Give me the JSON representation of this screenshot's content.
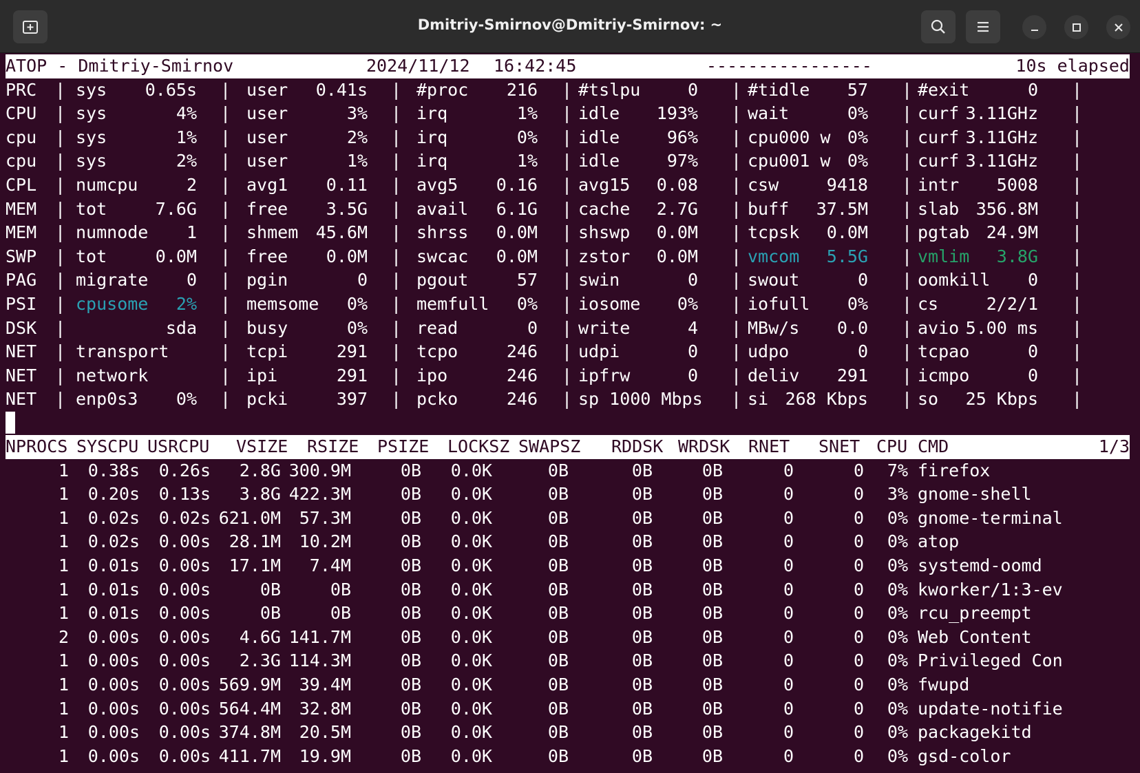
{
  "window": {
    "title": "Dmitriy-Smirnov@Dmitriy-Smirnov: ~"
  },
  "header": {
    "app": "ATOP - Dmitriy-Smirnov",
    "date": "2024/11/12",
    "time": "16:42:45",
    "dashes": "----------------",
    "elapsed": "10s elapsed"
  },
  "sys_rows": [
    {
      "label": "PRC",
      "cells": [
        {
          "k": "sys",
          "v": "0.65s"
        },
        {
          "k": "user",
          "v": "0.41s"
        },
        {
          "k": "#proc",
          "v": "216"
        },
        {
          "k": "#tslpu",
          "v": "0"
        },
        {
          "k": "#tidle",
          "v": "57"
        },
        {
          "k": "#exit",
          "v": "0"
        }
      ]
    },
    {
      "label": "CPU",
      "cells": [
        {
          "k": "sys",
          "v": "4%"
        },
        {
          "k": "user",
          "v": "3%"
        },
        {
          "k": "irq",
          "v": "1%"
        },
        {
          "k": "idle",
          "v": "193%"
        },
        {
          "k": "wait",
          "v": "0%"
        },
        {
          "k": "curf",
          "v": "3.11GHz"
        }
      ]
    },
    {
      "label": "cpu",
      "cells": [
        {
          "k": "sys",
          "v": "1%"
        },
        {
          "k": "user",
          "v": "2%"
        },
        {
          "k": "irq",
          "v": "0%"
        },
        {
          "k": "idle",
          "v": "96%"
        },
        {
          "k": "cpu000 w",
          "v": "0%"
        },
        {
          "k": "curf",
          "v": "3.11GHz"
        }
      ]
    },
    {
      "label": "cpu",
      "cells": [
        {
          "k": "sys",
          "v": "2%"
        },
        {
          "k": "user",
          "v": "1%"
        },
        {
          "k": "irq",
          "v": "1%"
        },
        {
          "k": "idle",
          "v": "97%"
        },
        {
          "k": "cpu001 w",
          "v": "0%"
        },
        {
          "k": "curf",
          "v": "3.11GHz"
        }
      ]
    },
    {
      "label": "CPL",
      "cells": [
        {
          "k": "numcpu",
          "v": "2"
        },
        {
          "k": "avg1",
          "v": "0.11"
        },
        {
          "k": "avg5",
          "v": "0.16"
        },
        {
          "k": "avg15",
          "v": "0.08"
        },
        {
          "k": "csw",
          "v": "9418"
        },
        {
          "k": "intr",
          "v": "5008"
        }
      ]
    },
    {
      "label": "MEM",
      "cells": [
        {
          "k": "tot",
          "v": "7.6G"
        },
        {
          "k": "free",
          "v": "3.5G"
        },
        {
          "k": "avail",
          "v": "6.1G"
        },
        {
          "k": "cache",
          "v": "2.7G"
        },
        {
          "k": "buff",
          "v": "37.5M"
        },
        {
          "k": "slab",
          "v": "356.8M"
        }
      ]
    },
    {
      "label": "MEM",
      "cells": [
        {
          "k": "numnode",
          "v": "1"
        },
        {
          "k": "shmem",
          "v": "45.6M"
        },
        {
          "k": "shrss",
          "v": "0.0M"
        },
        {
          "k": "shswp",
          "v": "0.0M"
        },
        {
          "k": "tcpsk",
          "v": "0.0M"
        },
        {
          "k": "pgtab",
          "v": "24.9M"
        }
      ]
    },
    {
      "label": "SWP",
      "cells": [
        {
          "k": "tot",
          "v": "0.0M"
        },
        {
          "k": "free",
          "v": "0.0M"
        },
        {
          "k": "swcac",
          "v": "0.0M"
        },
        {
          "k": "zstor",
          "v": "0.0M"
        },
        {
          "k": "vmcom",
          "v": "5.5G",
          "color": "cyan"
        },
        {
          "k": "vmlim",
          "v": "3.8G",
          "color": "green"
        }
      ]
    },
    {
      "label": "PAG",
      "cells": [
        {
          "k": "migrate",
          "v": "0"
        },
        {
          "k": "pgin",
          "v": "0"
        },
        {
          "k": "pgout",
          "v": "57"
        },
        {
          "k": "swin",
          "v": "0"
        },
        {
          "k": "swout",
          "v": "0"
        },
        {
          "k": "oomkill",
          "v": "0"
        }
      ]
    },
    {
      "label": "PSI",
      "cells": [
        {
          "k": "cpusome",
          "v": "2%",
          "color": "cyan"
        },
        {
          "k": "memsome",
          "v": "0%"
        },
        {
          "k": "memfull",
          "v": "0%"
        },
        {
          "k": "iosome",
          "v": "0%"
        },
        {
          "k": "iofull",
          "v": "0%"
        },
        {
          "k": "cs",
          "v": "2/2/1"
        }
      ]
    },
    {
      "label": "DSK",
      "cells": [
        {
          "k": "",
          "v": "sda"
        },
        {
          "k": "busy",
          "v": "0%"
        },
        {
          "k": "read",
          "v": "0"
        },
        {
          "k": "write",
          "v": "4"
        },
        {
          "k": "MBw/s",
          "v": "0.0"
        },
        {
          "k": "avio",
          "v": "5.00 ms"
        }
      ]
    },
    {
      "label": "NET",
      "cells": [
        {
          "k": "transport",
          "v": ""
        },
        {
          "k": "tcpi",
          "v": "291"
        },
        {
          "k": "tcpo",
          "v": "246"
        },
        {
          "k": "udpi",
          "v": "0"
        },
        {
          "k": "udpo",
          "v": "0"
        },
        {
          "k": "tcpao",
          "v": "0"
        }
      ]
    },
    {
      "label": "NET",
      "cells": [
        {
          "k": "network",
          "v": ""
        },
        {
          "k": "ipi",
          "v": "291"
        },
        {
          "k": "ipo",
          "v": "246"
        },
        {
          "k": "ipfrw",
          "v": "0"
        },
        {
          "k": "deliv",
          "v": "291"
        },
        {
          "k": "icmpo",
          "v": "0"
        }
      ]
    },
    {
      "label": "NET",
      "cells": [
        {
          "k": "enp0s3",
          "v": "0%"
        },
        {
          "k": "pcki",
          "v": "397"
        },
        {
          "k": "pcko",
          "v": "246"
        },
        {
          "k": "sp 1000 Mbps",
          "v": ""
        },
        {
          "k": "si",
          "v": "268 Kbps"
        },
        {
          "k": "so",
          "v": "25 Kbps"
        }
      ]
    }
  ],
  "proc_header": {
    "columns": [
      "NPROCS",
      "SYSCPU",
      "USRCPU",
      "VSIZE",
      "RSIZE",
      "PSIZE",
      "LOCKSZ",
      "SWAPSZ",
      "RDDSK",
      "WRDSK",
      "RNET",
      "SNET",
      "CPU",
      "CMD"
    ],
    "page": "1/3"
  },
  "processes": [
    [
      "1",
      "0.38s",
      "0.26s",
      "2.8G",
      "300.9M",
      "0B",
      "0.0K",
      "0B",
      "0B",
      "0B",
      "0",
      "0",
      "7%",
      "firefox"
    ],
    [
      "1",
      "0.20s",
      "0.13s",
      "3.8G",
      "422.3M",
      "0B",
      "0.0K",
      "0B",
      "0B",
      "0B",
      "0",
      "0",
      "3%",
      "gnome-shell"
    ],
    [
      "1",
      "0.02s",
      "0.02s",
      "621.0M",
      "57.3M",
      "0B",
      "0.0K",
      "0B",
      "0B",
      "0B",
      "0",
      "0",
      "0%",
      "gnome-terminal"
    ],
    [
      "1",
      "0.02s",
      "0.00s",
      "28.1M",
      "10.2M",
      "0B",
      "0.0K",
      "0B",
      "0B",
      "0B",
      "0",
      "0",
      "0%",
      "atop"
    ],
    [
      "1",
      "0.01s",
      "0.00s",
      "17.1M",
      "7.4M",
      "0B",
      "0.0K",
      "0B",
      "0B",
      "0B",
      "0",
      "0",
      "0%",
      "systemd-oomd"
    ],
    [
      "1",
      "0.01s",
      "0.00s",
      "0B",
      "0B",
      "0B",
      "0.0K",
      "0B",
      "0B",
      "0B",
      "0",
      "0",
      "0%",
      "kworker/1:3-ev"
    ],
    [
      "1",
      "0.01s",
      "0.00s",
      "0B",
      "0B",
      "0B",
      "0.0K",
      "0B",
      "0B",
      "0B",
      "0",
      "0",
      "0%",
      "rcu_preempt"
    ],
    [
      "2",
      "0.00s",
      "0.00s",
      "4.6G",
      "141.7M",
      "0B",
      "0.0K",
      "0B",
      "0B",
      "0B",
      "0",
      "0",
      "0%",
      "Web Content"
    ],
    [
      "1",
      "0.00s",
      "0.00s",
      "2.3G",
      "114.3M",
      "0B",
      "0.0K",
      "0B",
      "0B",
      "0B",
      "0",
      "0",
      "0%",
      "Privileged Con"
    ],
    [
      "1",
      "0.00s",
      "0.00s",
      "569.9M",
      "39.4M",
      "0B",
      "0.0K",
      "0B",
      "0B",
      "0B",
      "0",
      "0",
      "0%",
      "fwupd"
    ],
    [
      "1",
      "0.00s",
      "0.00s",
      "564.4M",
      "32.8M",
      "0B",
      "0.0K",
      "0B",
      "0B",
      "0B",
      "0",
      "0",
      "0%",
      "update-notifie"
    ],
    [
      "1",
      "0.00s",
      "0.00s",
      "374.8M",
      "20.5M",
      "0B",
      "0.0K",
      "0B",
      "0B",
      "0B",
      "0",
      "0",
      "0%",
      "packagekitd"
    ],
    [
      "1",
      "0.00s",
      "0.00s",
      "411.7M",
      "19.9M",
      "0B",
      "0.0K",
      "0B",
      "0B",
      "0B",
      "0",
      "0",
      "0%",
      "gsd-color"
    ]
  ]
}
